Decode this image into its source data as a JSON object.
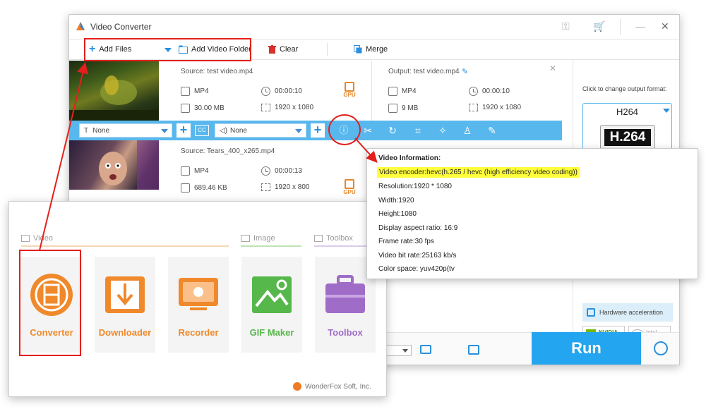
{
  "window": {
    "title": "Video Converter"
  },
  "toolbar": {
    "add_files": "Add Files",
    "add_video_folder": "Add Video Folder",
    "clear": "Clear",
    "merge": "Merge"
  },
  "tasks": [
    {
      "source": "Source: test video.mp4",
      "format": "MP4",
      "duration": "00:00:10",
      "size": "30.00 MB",
      "resolution": "1920 x 1080",
      "output": "Output: test video.mp4",
      "out_format": "MP4",
      "out_duration": "00:00:10",
      "out_size": "9 MB",
      "out_resolution": "1920 x 1080",
      "gpu": "GPU"
    },
    {
      "source": "Source: Tears_400_x265.mp4",
      "format": "MP4",
      "duration": "00:00:13",
      "size": "689.46 KB",
      "resolution": "1920 x 800",
      "gpu": "GPU"
    }
  ],
  "opbar": {
    "subtitle": "None",
    "audio": "None",
    "cc": "CC"
  },
  "right_panel": {
    "hint": "Click to change output format:",
    "format": "H264",
    "format_badge": "H.264",
    "hw_accel": "Hardware acceleration",
    "nvidia": "NVIDIA",
    "intel": "Intel"
  },
  "run_label": "Run",
  "info": {
    "heading": "Video Information:",
    "lines": [
      "Video encoder:hevc(h.265 / hevc (high efficiency video coding))",
      "Resolution:1920 * 1080",
      "Width:1920",
      "Height:1080",
      "Display aspect ratio: 16:9",
      "Frame rate:30 fps",
      "Video bit rate:25163 kb/s",
      "Color space: yuv420p(tv"
    ],
    "highlight_color": "#ffff3a"
  },
  "home": {
    "categories": {
      "video": "Video",
      "image": "Image",
      "toolbox": "Toolbox"
    },
    "tiles": [
      {
        "label": "Converter",
        "color": "#f0892b"
      },
      {
        "label": "Downloader",
        "color": "#f0892b"
      },
      {
        "label": "Recorder",
        "color": "#f0892b"
      },
      {
        "label": "GIF Maker",
        "color": "#56b74a"
      },
      {
        "label": "Toolbox",
        "color": "#9f6cc7"
      }
    ],
    "brand": "WonderFox Soft, Inc."
  },
  "colors": {
    "accent_blue": "#23a5ef",
    "bar_blue": "#58b8ee",
    "annotation_red": "#e3201c",
    "orange": "#f0892b"
  }
}
